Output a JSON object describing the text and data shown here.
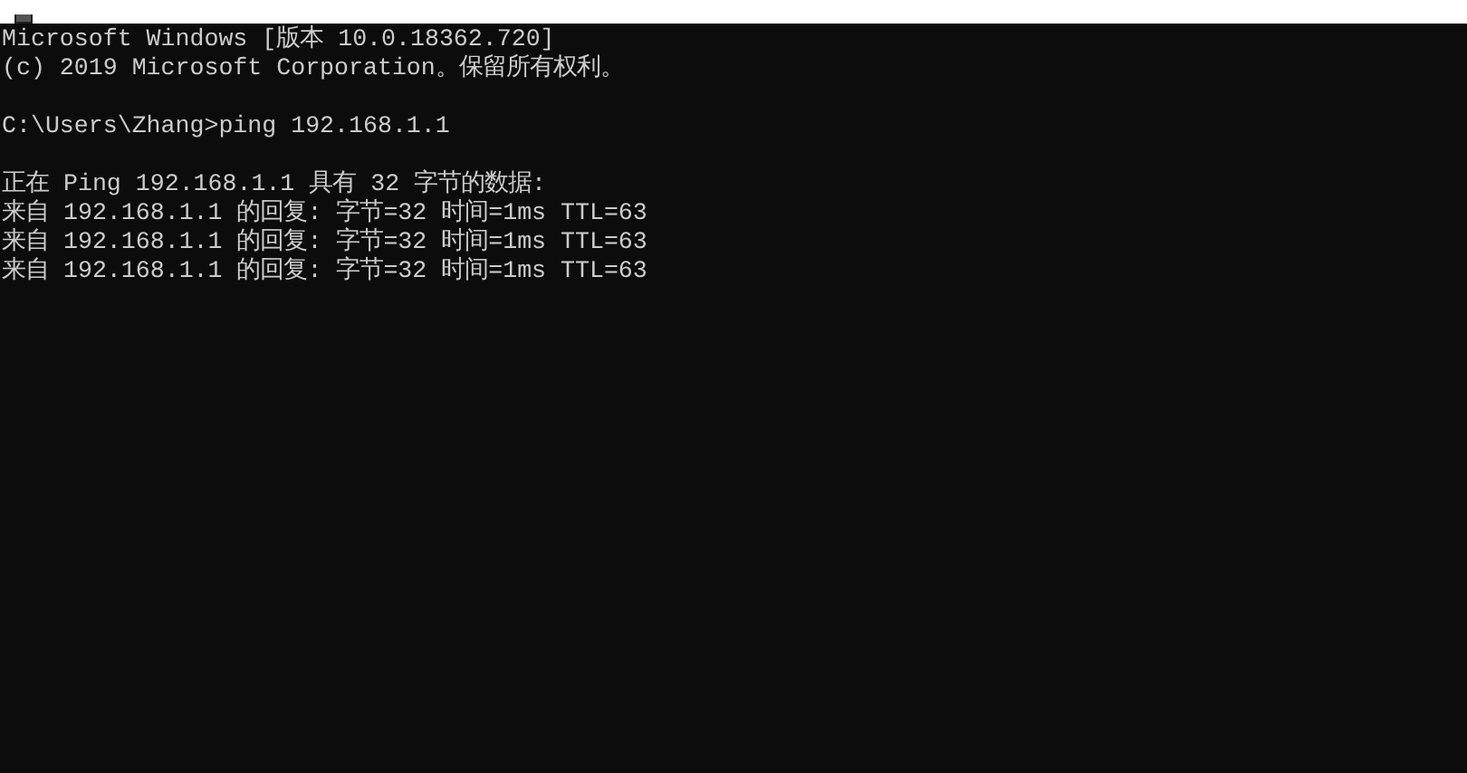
{
  "console": {
    "blocks": [
      [
        "Microsoft Windows [版本 10.0.18362.720]",
        "(c) 2019 Microsoft Corporation。保留所有权利。"
      ],
      [
        "C:\\Users\\Zhang>ping 192.168.1.1"
      ],
      [
        "正在 Ping 192.168.1.1 具有 32 字节的数据:",
        "来自 192.168.1.1 的回复: 字节=32 时间=1ms TTL=63",
        "来自 192.168.1.1 的回复: 字节=32 时间=1ms TTL=63",
        "来自 192.168.1.1 的回复: 字节=32 时间=1ms TTL=63"
      ]
    ]
  }
}
